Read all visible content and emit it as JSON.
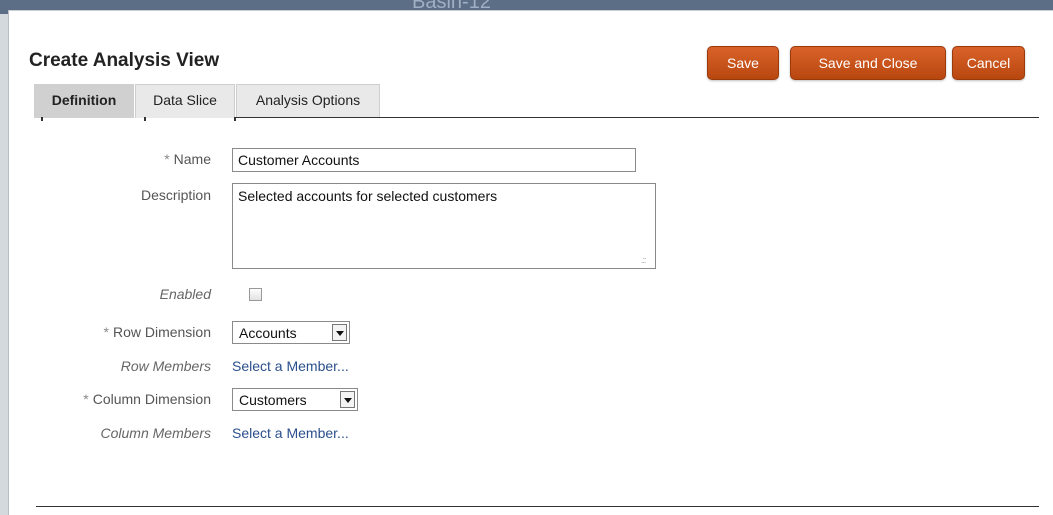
{
  "background": {
    "window_title_fragment": "Basin-12"
  },
  "dialog": {
    "title": "Create Analysis View",
    "buttons": {
      "save": "Save",
      "save_and_close": "Save and Close",
      "cancel": "Cancel"
    },
    "tabs": [
      {
        "label": "Definition",
        "active": true
      },
      {
        "label": "Data Slice",
        "active": false
      },
      {
        "label": "Analysis Options",
        "active": false
      }
    ],
    "form": {
      "required_marker": "*",
      "name": {
        "label": "Name",
        "value": "Customer Accounts"
      },
      "description": {
        "label": "Description",
        "value": "Selected accounts for selected customers"
      },
      "enabled": {
        "label": "Enabled",
        "checked": false
      },
      "row_dimension": {
        "label": "Row Dimension",
        "value": "Accounts"
      },
      "row_members": {
        "label": "Row Members",
        "link": "Select a Member..."
      },
      "column_dimension": {
        "label": "Column Dimension",
        "value": "Customers"
      },
      "column_members": {
        "label": "Column Members",
        "link": "Select a Member..."
      }
    }
  },
  "colors": {
    "button": "#c85418",
    "link": "#2b4f8c",
    "active_tab": "#d0d0d0"
  }
}
